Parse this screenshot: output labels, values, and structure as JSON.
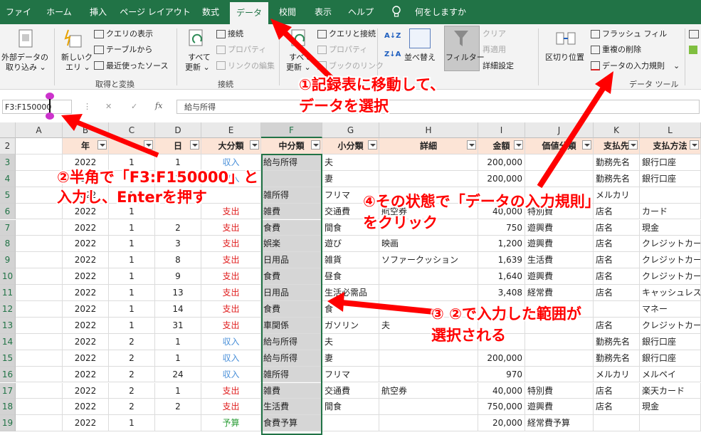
{
  "tabs": [
    "ファイル",
    "ホーム",
    "挿入",
    "ページ レイアウト",
    "数式",
    "データ",
    "校閲",
    "表示",
    "ヘルプ",
    "何をしますか"
  ],
  "ribbon": {
    "external_data": [
      "外部データの",
      "取り込み ⌄"
    ],
    "new_query": [
      "新しいク",
      "エリ ⌄"
    ],
    "query_show": "クエリの表示",
    "from_table": "テーブルから",
    "recent_sources": "最近使ったソース",
    "group_get_transform": "取得と変換",
    "refresh_all": [
      "すべて",
      "更新 ⌄"
    ],
    "connections": "接続",
    "properties": "プロパティ",
    "edit_links": "リンクの編集",
    "group_connections": "接続",
    "refresh_all2": [
      "すべて",
      "更新 ⌄"
    ],
    "queries_connections": "クエリと接続",
    "properties2": "プロパティ",
    "workbook_links": "ブックのリンク",
    "sort_az": "A↓Z",
    "sort_za": "Z↓A",
    "sort": "並べ替え",
    "filter": "フィルター",
    "clear": "クリア",
    "reapply": "再適用",
    "advanced": "詳細設定",
    "text_to_columns": "区切り位置",
    "flash_fill": "フラッシュ フィル",
    "remove_duplicates": "重複の削除",
    "data_validation": "データの入力規則",
    "group_data_tools": "データ ツール"
  },
  "formula_bar": {
    "name_box": "F3:F150000",
    "cancel": "✕",
    "enter": "✓",
    "fx": "fx",
    "content": "給与所得"
  },
  "columns": [
    "A",
    "B",
    "C",
    "D",
    "E",
    "F",
    "G",
    "H",
    "I",
    "J",
    "K",
    "L"
  ],
  "header_row": {
    "num": "2",
    "B": "年",
    "C": "",
    "D": "日",
    "E": "大分類",
    "F": "中分類",
    "G": "小分類",
    "H": "詳細",
    "I": "金額",
    "J": "価値分類",
    "K": "支払先",
    "L": "支払方法"
  },
  "rows": [
    {
      "num": "3",
      "B": "2022",
      "C": "1",
      "D": "1",
      "E": "収入",
      "F": "給与所得",
      "G": "夫",
      "H": "",
      "I": "200,000",
      "J": "",
      "K": "勤務先名",
      "L": "銀行口座"
    },
    {
      "num": "4",
      "B": "2022",
      "C": "1",
      "D": "1",
      "E": "収入",
      "F": "",
      "G": "妻",
      "H": "",
      "I": "200,000",
      "J": "",
      "K": "勤務先名",
      "L": "銀行口座"
    },
    {
      "num": "5",
      "B": "2022",
      "C": "1",
      "D": "",
      "E": "",
      "F": "雑所得",
      "G": "フリマ",
      "H": "",
      "I": "",
      "J": "",
      "K": "メルカリ",
      "L": ""
    },
    {
      "num": "6",
      "B": "2022",
      "C": "1",
      "D": "",
      "E": "支出",
      "F": "雑費",
      "G": "交通費",
      "H": "航空券",
      "I": "40,000",
      "J": "特別費",
      "K": "店名",
      "L": "カード"
    },
    {
      "num": "7",
      "B": "2022",
      "C": "1",
      "D": "2",
      "E": "支出",
      "F": "食費",
      "G": "間食",
      "H": "",
      "I": "750",
      "J": "遊興費",
      "K": "店名",
      "L": "現金"
    },
    {
      "num": "8",
      "B": "2022",
      "C": "1",
      "D": "3",
      "E": "支出",
      "F": "娯楽",
      "G": "遊び",
      "H": "映画",
      "I": "1,200",
      "J": "遊興費",
      "K": "店名",
      "L": "クレジットカー"
    },
    {
      "num": "9",
      "B": "2022",
      "C": "1",
      "D": "8",
      "E": "支出",
      "F": "日用品",
      "G": "雑貨",
      "H": "ソファークッション",
      "I": "1,639",
      "J": "生活費",
      "K": "店名",
      "L": "クレジットカー"
    },
    {
      "num": "10",
      "B": "2022",
      "C": "1",
      "D": "9",
      "E": "支出",
      "F": "食費",
      "G": "昼食",
      "H": "",
      "I": "1,640",
      "J": "遊興費",
      "K": "店名",
      "L": "クレジットカー"
    },
    {
      "num": "11",
      "B": "2022",
      "C": "1",
      "D": "13",
      "E": "支出",
      "F": "日用品",
      "G": "生活必需品",
      "H": "",
      "I": "3,408",
      "J": "経常費",
      "K": "店名",
      "L": "キャッシュレス"
    },
    {
      "num": "12",
      "B": "2022",
      "C": "1",
      "D": "14",
      "E": "支出",
      "F": "食費",
      "G": "食",
      "H": "",
      "I": "",
      "J": "",
      "K": "",
      "L": "マネー"
    },
    {
      "num": "13",
      "B": "2022",
      "C": "1",
      "D": "31",
      "E": "支出",
      "F": "車関係",
      "G": "ガソリン",
      "H": "夫",
      "I": "",
      "J": "",
      "K": "店名",
      "L": "クレジットカー"
    },
    {
      "num": "14",
      "B": "2022",
      "C": "2",
      "D": "1",
      "E": "収入",
      "F": "給与所得",
      "G": "夫",
      "H": "",
      "I": "",
      "J": "",
      "K": "勤務先名",
      "L": "銀行口座"
    },
    {
      "num": "15",
      "B": "2022",
      "C": "2",
      "D": "1",
      "E": "収入",
      "F": "給与所得",
      "G": "妻",
      "H": "",
      "I": "200,000",
      "J": "",
      "K": "勤務先名",
      "L": "銀行口座"
    },
    {
      "num": "16",
      "B": "2022",
      "C": "2",
      "D": "24",
      "E": "収入",
      "F": "雑所得",
      "G": "フリマ",
      "H": "",
      "I": "970",
      "J": "",
      "K": "メルカリ",
      "L": "メルペイ"
    },
    {
      "num": "17",
      "B": "2022",
      "C": "2",
      "D": "1",
      "E": "支出",
      "F": "雑費",
      "G": "交通費",
      "H": "航空券",
      "I": "40,000",
      "J": "特別費",
      "K": "店名",
      "L": "楽天カード"
    },
    {
      "num": "18",
      "B": "2022",
      "C": "2",
      "D": "2",
      "E": "支出",
      "F": "生活費",
      "G": "間食",
      "H": "",
      "I": "750,000",
      "J": "遊興費",
      "K": "店名",
      "L": "現金"
    },
    {
      "num": "19",
      "B": "2022",
      "C": "1",
      "D": "",
      "E": "予算",
      "F": "食費予算",
      "G": "",
      "H": "",
      "I": "20,000",
      "J": "経常費予算",
      "K": "",
      "L": ""
    }
  ],
  "annotations": {
    "step1_line1": "①記録表に移動して、",
    "step1_line2": "データを選択",
    "step2_line1": "②半角で「F3:F150000」と",
    "step2_line2": "入力し、Enterを押す",
    "step3_line1": "③ ②で入力した範囲が",
    "step3_line2": "選択される",
    "step4_line1": "④その状態で「データの入力規則」",
    "step4_line2": "をクリック"
  },
  "colors": {
    "excel_green": "#217346",
    "header_fill": "#fce4d6",
    "annotation_red": "#ff0000",
    "income": "#4a90d9",
    "expense": "#e02020",
    "budget": "#2e9e3a",
    "selection_gray": "#d6d6d6"
  }
}
